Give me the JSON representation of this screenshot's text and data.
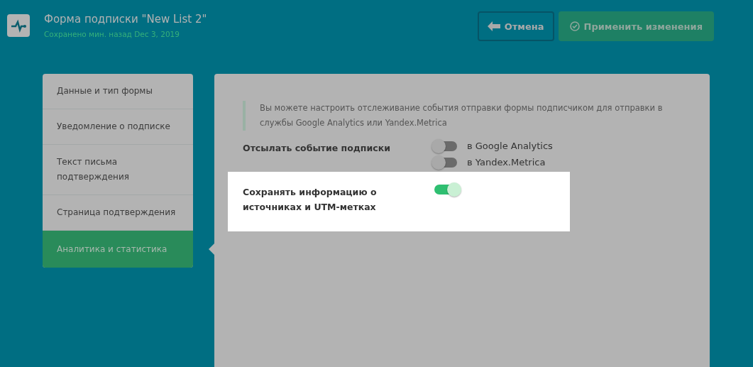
{
  "header": {
    "title": "Форма подписки \"New List 2\"",
    "subtitle": "Сохранено мин. назад Dec 3, 2019"
  },
  "buttons": [
    {
      "kind": "cancel",
      "label": "Отмена"
    },
    {
      "kind": "apply",
      "label": "Применить изменения"
    }
  ],
  "sidebar": {
    "items": [
      {
        "label": "Данные и тип формы",
        "selected": false
      },
      {
        "label": "Уведомление о подписке",
        "selected": false
      },
      {
        "label": "Текст письма подтверждения",
        "selected": false
      },
      {
        "label": "Страница подтверждения",
        "selected": false
      },
      {
        "label": "Аналитика и статистика",
        "selected": true
      }
    ]
  },
  "panel": {
    "note": "Вы можете настроить отслеживание события отправки формы подписчиком для отправки в службы Google Analytics или Yandex.Metrica",
    "settings": [
      {
        "label": "Отсылать событие подписки",
        "highlighted": false,
        "toggles": [
          {
            "label": "в Google Analytics",
            "on": false
          },
          {
            "label": "в Yandex.Metrica",
            "on": false
          }
        ]
      },
      {
        "label": "Сохранять информацию о источниках и UTM-метках",
        "highlighted": true,
        "toggles": [
          {
            "on": true
          }
        ]
      }
    ]
  }
}
